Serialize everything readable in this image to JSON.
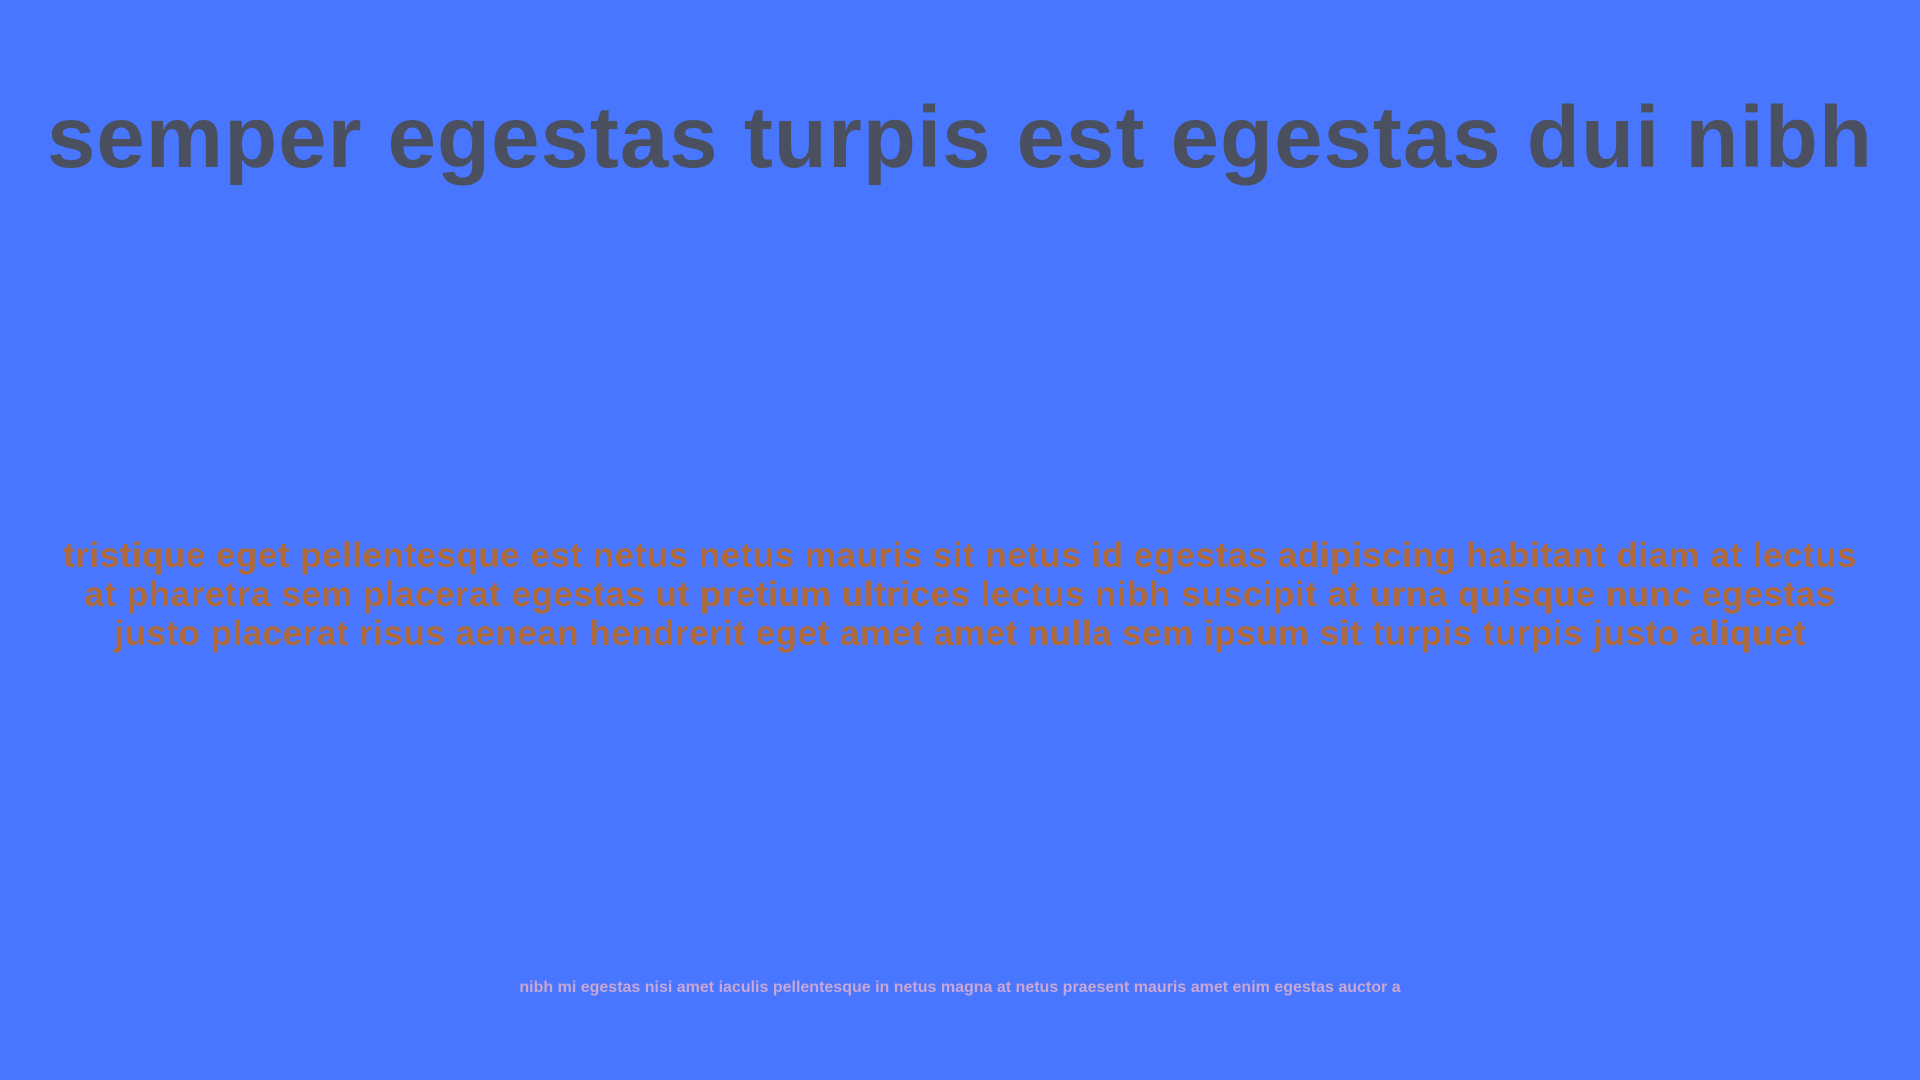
{
  "page": {
    "background_color": "#4876ff",
    "title": "semper egestas turpis est egestas dui nibh",
    "body": "tristique eget pellentesque est netus netus mauris sit netus id egestas adipiscing habitant diam at lectus at pharetra sem placerat egestas ut pretium ultrices lectus nibh suscipit at urna quisque nunc egestas justo placerat risus aenean hendrerit eget amet amet nulla sem ipsum sit turpis turpis justo aliquet",
    "footer": "nibh mi egestas nisi amet iaculis pellentesque in netus magna at netus praesent mauris amet enim egestas auctor a"
  },
  "colors": {
    "title": "#4a5060",
    "body": "#b06a3a",
    "footer": "#c8a6d6"
  }
}
